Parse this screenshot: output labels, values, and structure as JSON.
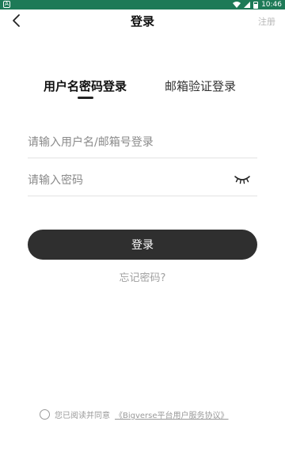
{
  "status_bar": {
    "left_icon": "A",
    "time": "10:46",
    "icons": [
      "wifi-icon",
      "signal-icon",
      "battery-icon"
    ]
  },
  "header": {
    "title": "登录",
    "back_icon": "chevron-left-icon",
    "register_label": "注册"
  },
  "tabs": [
    {
      "label": "用户名密码登录",
      "active": true
    },
    {
      "label": "邮箱验证登录",
      "active": false
    }
  ],
  "form": {
    "username_placeholder": "请输入用户名/邮箱号登录",
    "username_value": "",
    "password_placeholder": "请输入密码",
    "password_value": "",
    "password_toggle_icon": "eye-closed-icon"
  },
  "login_button_label": "登录",
  "forgot_password_label": "忘记密码?",
  "agreement": {
    "prefix": "您已阅读并同意",
    "link": "《Bigverse平台用户服务协议》",
    "checked": false
  },
  "colors": {
    "status_bar": "#1e7a57",
    "primary_button": "#2f2f2f",
    "muted_text": "#a0a0a0"
  }
}
